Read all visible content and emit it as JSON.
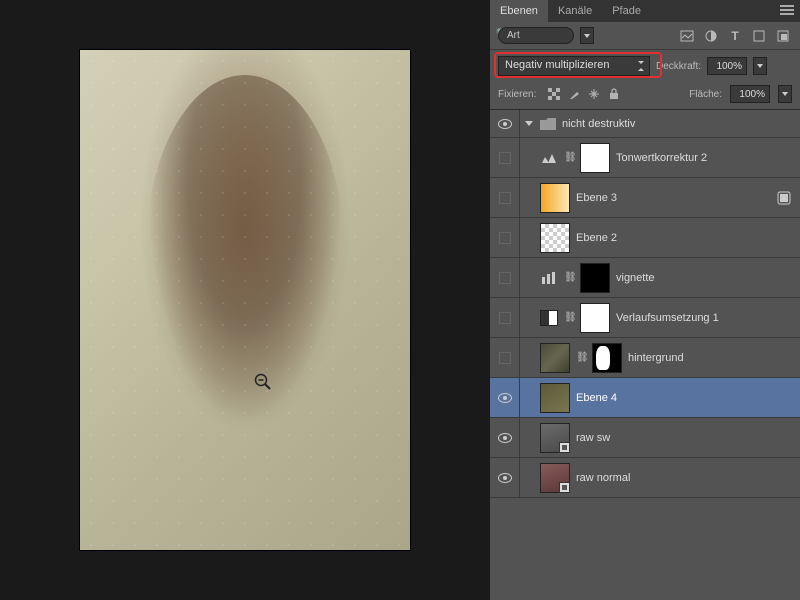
{
  "tabs": {
    "layers": "Ebenen",
    "channels": "Kanäle",
    "paths": "Pfade"
  },
  "filter": {
    "placeholder": "Art"
  },
  "blend": {
    "mode": "Negativ multiplizieren",
    "opacity_label": "Deckkraft:",
    "opacity_value": "100%"
  },
  "lock": {
    "label": "Fixieren:",
    "fill_label": "Fläche:",
    "fill_value": "100%"
  },
  "group": {
    "name": "nicht destruktiv"
  },
  "layers": [
    {
      "name": "Tonwertkorrektur 2",
      "visible": false,
      "type": "levels"
    },
    {
      "name": "Ebene 3",
      "visible": false,
      "type": "pixel",
      "thumb": "orange-grad",
      "fx": true
    },
    {
      "name": "Ebene 2",
      "visible": false,
      "type": "pixel",
      "thumb": "checker"
    },
    {
      "name": "vignette",
      "visible": false,
      "type": "adjust-link",
      "mask": "black"
    },
    {
      "name": "Verlaufsumsetzung 1",
      "visible": false,
      "type": "gradmap"
    },
    {
      "name": "hintergrund",
      "visible": false,
      "type": "pixel-link",
      "thumb": "texture",
      "mask": "hg-mask"
    },
    {
      "name": "Ebene 4",
      "visible": true,
      "type": "pixel",
      "thumb": "ebene4",
      "selected": true
    },
    {
      "name": "raw sw",
      "visible": true,
      "type": "smart",
      "thumb": "rawsw"
    },
    {
      "name": "raw normal",
      "visible": true,
      "type": "smart",
      "thumb": "rawnormal"
    }
  ]
}
